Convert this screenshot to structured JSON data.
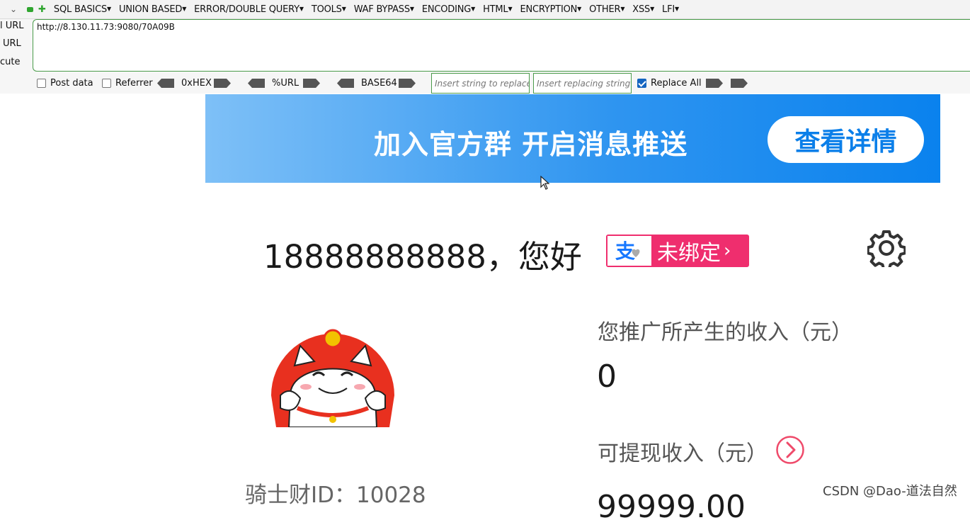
{
  "toolbar": {
    "menu": [
      "SQL BASICS",
      "UNION BASED",
      "ERROR/DOUBLE QUERY",
      "TOOLS",
      "WAF BYPASS",
      "ENCODING",
      "HTML",
      "ENCRYPTION",
      "OTHER",
      "XSS",
      "LFI"
    ],
    "labels": {
      "load_url": "l URL",
      "split_url": "URL",
      "execute": "cute"
    },
    "url_value": "http://8.130.11.73:9080/70A09B",
    "post_data_label": "Post data",
    "referrer_label": "Referrer",
    "hex_label": "0xHEX",
    "url_label": "%URL",
    "base64_label": "BASE64",
    "replace_placeholder": "Insert string to replace",
    "replacing_placeholder": "Insert replacing string",
    "replace_all_label": "Replace All",
    "replace_all_checked": true
  },
  "banner": {
    "text": "加入官方群  开启消息推送",
    "button_label": "查看详情",
    "colors": {
      "start": "#7ec0f7",
      "end": "#0a82ee"
    }
  },
  "profile": {
    "greeting": "18888888888，您好",
    "bind_status": "未绑定",
    "knight_id": "骑士财ID：10028"
  },
  "earnings": {
    "income_label": "您推广所产生的收入（元）",
    "income_value": "0",
    "withdraw_label": "可提现收入（元）",
    "withdraw_value": "99999.00"
  },
  "watermark": "CSDN @Dao-道法自然",
  "colors": {
    "accent_pink": "#ef2e6e",
    "blue": "#0b7fe9",
    "green_border": "#4a9b4a"
  }
}
